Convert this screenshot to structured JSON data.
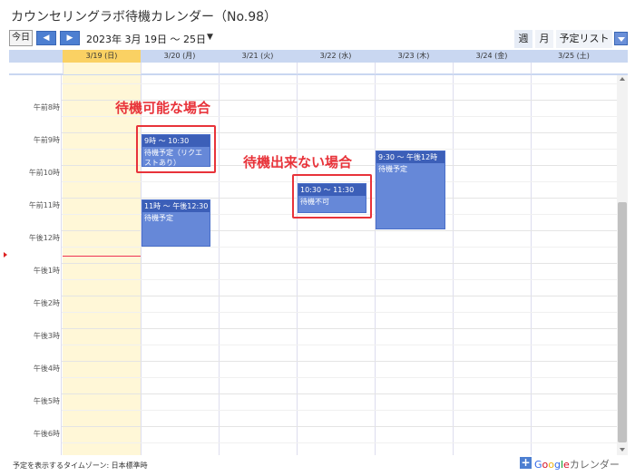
{
  "window": {
    "title": "カウンセリングラボ待機カレンダー（No.98）"
  },
  "toolbar": {
    "today_label": "今日",
    "prev_icon": "◀",
    "next_icon": "▶",
    "date_range": "2023年 3月 19日 ～ 25日",
    "dropdown_icon": "▼",
    "view_week": "週",
    "view_month": "月",
    "view_agenda": "予定リスト"
  },
  "days": [
    "3/19 (日)",
    "3/20 (月)",
    "3/21 (火)",
    "3/22 (水)",
    "3/23 (木)",
    "3/24 (金)",
    "3/25 (土)"
  ],
  "times": [
    "午前8時",
    "午前9時",
    "午前10時",
    "午前11時",
    "午後12時",
    "午後1時",
    "午後2時",
    "午後3時",
    "午後4時",
    "午後5時",
    "午後6時"
  ],
  "events": [
    {
      "time": "9時 ～ 10:30",
      "title": "待機予定（リクエストあり）"
    },
    {
      "time": "11時 ～ 午後12:30",
      "title": "待機予定"
    },
    {
      "time": "10:30 ～ 11:30",
      "title": "待機不可"
    },
    {
      "time": "9:30 ～ 午後12時",
      "title": "待機予定"
    }
  ],
  "callouts": {
    "available": "待機可能な場合",
    "unavailable": "待機出来ない場合"
  },
  "footer": {
    "timezone": "予定を表示するタイムゾーン: 日本標準時",
    "brand_plus": "+",
    "brand_google": [
      "G",
      "o",
      "o",
      "g",
      "l",
      "e"
    ],
    "brand_calendar": "カレンダー"
  },
  "colors": {
    "header_bg": "#c9d7f1",
    "today_header": "#fad163",
    "today_column": "#fff7d7",
    "event_bg": "#6688d8",
    "event_time_bg": "#3c5fb8",
    "annotation_red": "#e8333a",
    "now_line": "#e35"
  }
}
